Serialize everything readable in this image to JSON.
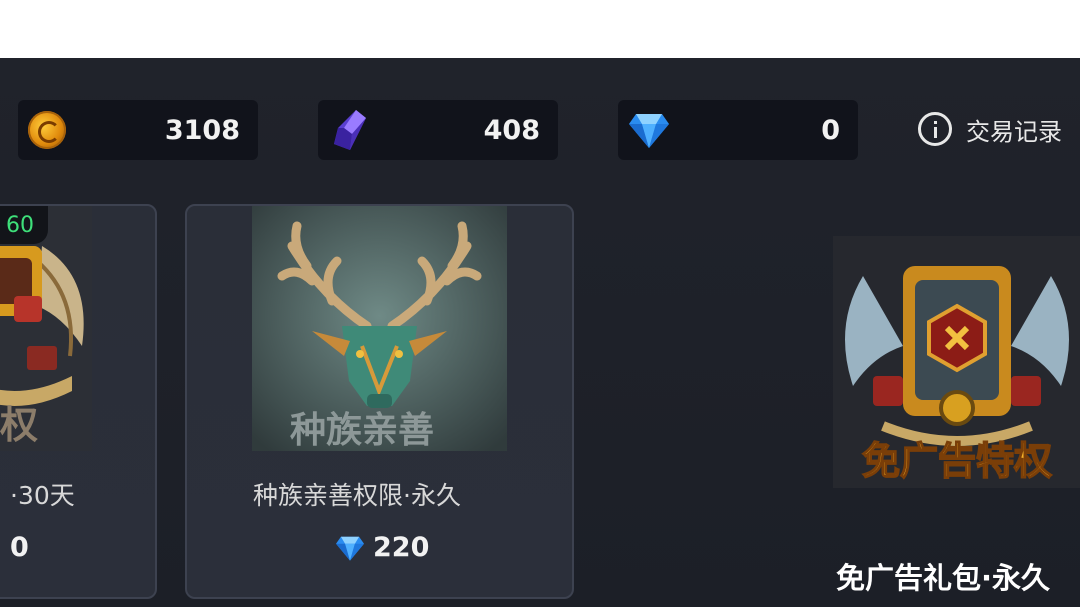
{
  "currencies": [
    {
      "name": "coin",
      "icon": "gold-coin-icon",
      "value": "3108"
    },
    {
      "name": "crystal",
      "icon": "purple-crystal-icon",
      "value": "408"
    },
    {
      "name": "diamond",
      "icon": "blue-diamond-icon",
      "value": "0"
    }
  ],
  "records": {
    "label": "交易记录",
    "icon": "info-icon"
  },
  "cards": [
    {
      "badge": "60",
      "title": "·30天",
      "price": "0",
      "art_text": "特权"
    },
    {
      "title": "种族亲善权限·永久",
      "price": "220",
      "price_icon": "blue-diamond-icon",
      "art_text": "种族亲善"
    }
  ],
  "feature": {
    "title": "免广告礼包·永久",
    "art_text": "免广告特权"
  },
  "colors": {
    "background": "#1e2129",
    "card": "#2a2e38",
    "accent_green": "#3ee07a",
    "gold": "#f5b21e"
  }
}
